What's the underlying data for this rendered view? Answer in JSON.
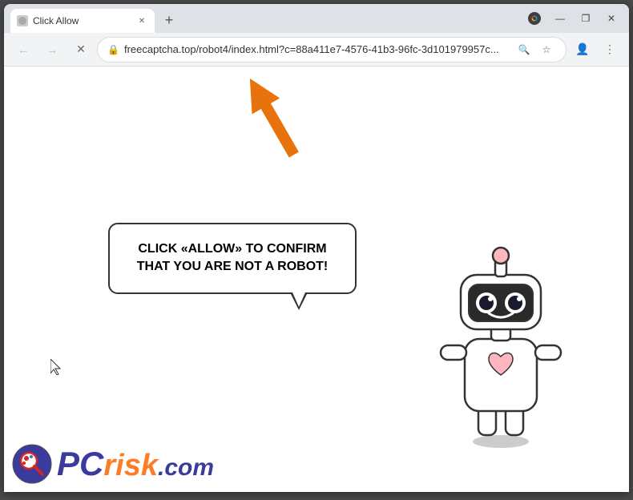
{
  "window": {
    "title": "Click Allow",
    "tab_label": "Click Allow",
    "new_tab_label": "+",
    "minimize": "—",
    "maximize": "❐",
    "close": "✕"
  },
  "toolbar": {
    "back_label": "←",
    "forward_label": "→",
    "reload_label": "✕",
    "address": "freecaptcha.top/robot4/index.html?c=88a411e7-4576-41b3-96fc-3d101979957c...",
    "search_icon": "🔍",
    "star_icon": "☆",
    "profile_icon": "👤",
    "menu_icon": "⋮"
  },
  "page": {
    "bubble_text": "CLICK «ALLOW» TO CONFIRM THAT YOU ARE NOT A ROBOT!",
    "watermark_pc": "PC",
    "watermark_risk": "risk",
    "watermark_com": ".com"
  },
  "colors": {
    "accent_orange": "#FF6600",
    "nav_blue": "#1a1a8c",
    "arrow_orange": "#E8720C"
  }
}
